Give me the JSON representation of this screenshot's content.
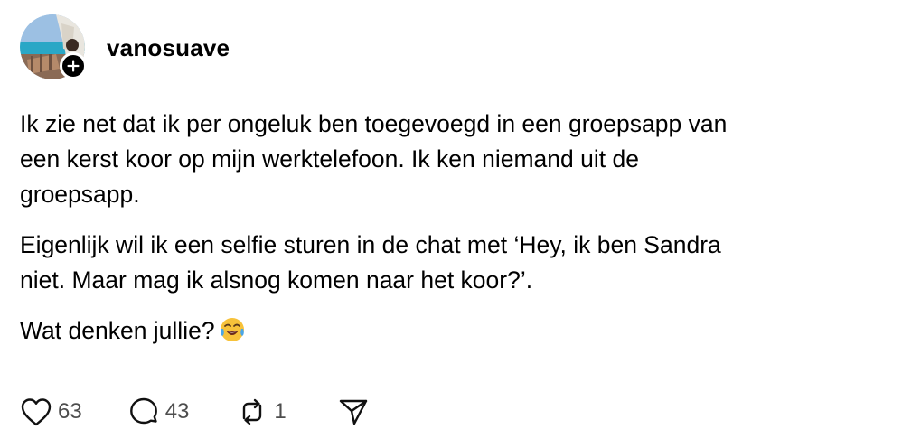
{
  "post": {
    "username": "vanosuave",
    "paragraphs": [
      "Ik zie net dat ik per ongeluk ben toegevoegd in een groepsapp van\neen kerst koor op mijn werktelefoon. Ik ken niemand uit de\ngroepsapp.",
      "Eigenlijk wil ik een selfie sturen in de chat met ‘Hey, ik ben Sandra\nniet. Maar mag ik alsnog komen naar het koor?’.",
      "Wat denken jullie?"
    ],
    "emoji": "face-with-tears-of-joy"
  },
  "actions": {
    "like": {
      "icon": "heart-icon",
      "count": "63"
    },
    "reply": {
      "icon": "comment-icon",
      "count": "43"
    },
    "repost": {
      "icon": "repost-icon",
      "count": "1"
    },
    "share": {
      "icon": "send-icon"
    }
  },
  "colors": {
    "text": "#000000",
    "muted": "#4d4d4d",
    "emoji_yellow": "#f7c23a",
    "emoji_tear": "#4aa6e8"
  }
}
